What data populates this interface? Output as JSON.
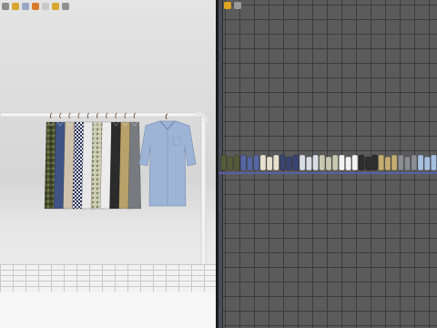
{
  "viewport3d": {
    "toolbar": [
      {
        "icon": "select-icon",
        "color": "#8a8a8a"
      },
      {
        "icon": "move-icon",
        "color": "#d9a530"
      },
      {
        "icon": "rotate-icon",
        "color": "#9aa7c4"
      },
      {
        "icon": "avatar-icon",
        "color": "#d97a2b"
      },
      {
        "icon": "fold-icon",
        "color": "#c9c9c9"
      },
      {
        "icon": "tag-icon",
        "color": "#d8a82e"
      },
      {
        "icon": "cloud-icon",
        "color": "#8f8f8f"
      }
    ],
    "garments": [
      {
        "name": "camo-shirt",
        "color": "#505834",
        "pattern": "camo"
      },
      {
        "name": "blue-shirt",
        "color": "#3f5485",
        "pattern": "solid"
      },
      {
        "name": "cream-shirt",
        "color": "#cfc2ad",
        "pattern": "solid"
      },
      {
        "name": "gingham-shirt",
        "color": "#2c345a",
        "pattern": "check"
      },
      {
        "name": "white-shirt",
        "color": "#e8e8e8",
        "pattern": "solid"
      },
      {
        "name": "floral-shirt",
        "color": "#b5b49a",
        "pattern": "floral"
      },
      {
        "name": "white-shirt-2",
        "color": "#ececec",
        "pattern": "solid"
      },
      {
        "name": "black-shirt",
        "color": "#2b2b2b",
        "pattern": "solid"
      },
      {
        "name": "khaki-shirt",
        "color": "#b9a26a",
        "pattern": "solid"
      },
      {
        "name": "grey-shirt",
        "color": "#777b80",
        "pattern": "solid"
      }
    ],
    "featured_garment": {
      "name": "light-blue-shirt",
      "color": "#9db4d6"
    }
  },
  "pattern2d": {
    "toolbar": [
      {
        "icon": "sun-icon",
        "color": "#e0a020"
      },
      {
        "icon": "gear-icon",
        "color": "#9a9a9a"
      }
    ],
    "pieces": [
      {
        "name": "camo-pieces",
        "color": "#555b3a"
      },
      {
        "name": "blue-pieces",
        "color": "#5566a0"
      },
      {
        "name": "cream-pieces",
        "color": "#e8e0cf"
      },
      {
        "name": "gingham-pieces",
        "color": "#3a4470"
      },
      {
        "name": "white-pieces",
        "color": "#d8dde5"
      },
      {
        "name": "floral-pieces",
        "color": "#c8c7b0"
      },
      {
        "name": "white-pieces-2",
        "color": "#f2f2f2"
      },
      {
        "name": "black-pieces",
        "color": "#2e2e2e"
      },
      {
        "name": "khaki-pieces",
        "color": "#c4ad72"
      },
      {
        "name": "grey-pieces",
        "color": "#8a8d92"
      },
      {
        "name": "lightblue-pieces",
        "color": "#a7bfe0"
      }
    ]
  }
}
